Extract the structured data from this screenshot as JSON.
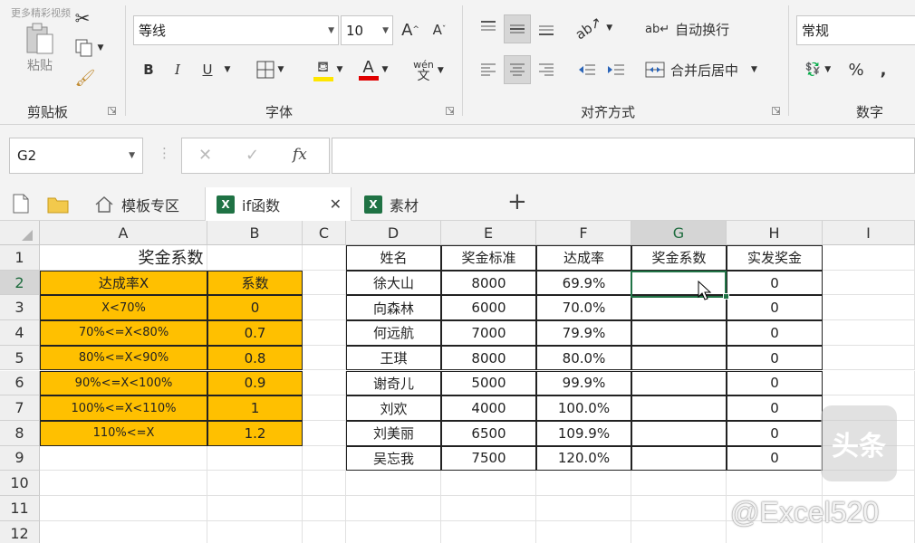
{
  "ribbon": {
    "watermark": "更多精彩视频",
    "clipboard": {
      "paste_label": "粘贴",
      "group_label": "剪贴板"
    },
    "font": {
      "font_name": "等线",
      "font_size": "10",
      "grow": "A",
      "shrink": "A",
      "bold": "B",
      "italic": "I",
      "underline": "U",
      "wen": "wén",
      "wen_char": "文",
      "font_color_letter": "A",
      "group_label": "字体"
    },
    "alignment": {
      "wrap_text": "自动换行",
      "merge_center": "合并后居中",
      "group_label": "对齐方式"
    },
    "number": {
      "format": "常规",
      "percent": "%",
      "comma": ",",
      "group_label": "数字"
    },
    "colors": {
      "highlight": "#ffe600",
      "font_red": "#e00000"
    }
  },
  "formula_bar": {
    "cell_ref": "G2",
    "cancel": "✕",
    "enter": "✓",
    "fx": "fx",
    "formula": ""
  },
  "tabs": [
    {
      "label": "模板专区",
      "icon": "home-icon"
    },
    {
      "label": "if函数",
      "icon": "excel-icon",
      "active": true,
      "close": "✕"
    },
    {
      "label": "素材",
      "icon": "excel-icon"
    }
  ],
  "tab_add": "+",
  "sheet": {
    "columns": [
      "A",
      "B",
      "C",
      "D",
      "E",
      "F",
      "G",
      "H",
      "I"
    ],
    "selected_column": "G",
    "rows": [
      "1",
      "2",
      "3",
      "4",
      "5",
      "6",
      "7",
      "8",
      "9",
      "10",
      "11",
      "12"
    ],
    "selected_row": "2",
    "left_table": {
      "title": "奖金系数",
      "headers": [
        "达成率X",
        "系数"
      ],
      "rows": [
        [
          "X<70%",
          "0"
        ],
        [
          "70%<=X<80%",
          "0.7"
        ],
        [
          "80%<=X<90%",
          "0.8"
        ],
        [
          "90%<=X<100%",
          "0.9"
        ],
        [
          "100%<=X<110%",
          "1"
        ],
        [
          "110%<=X",
          "1.2"
        ]
      ],
      "fill_color": "#ffc000"
    },
    "right_table": {
      "headers": [
        "姓名",
        "奖金标准",
        "达成率",
        "奖金系数",
        "实发奖金"
      ],
      "rows": [
        [
          "徐大山",
          "8000",
          "69.9%",
          "",
          "0"
        ],
        [
          "向森林",
          "6000",
          "70.0%",
          "",
          "0"
        ],
        [
          "何远航",
          "7000",
          "79.9%",
          "",
          "0"
        ],
        [
          "王琪",
          "8000",
          "80.0%",
          "",
          "0"
        ],
        [
          "谢奇儿",
          "5000",
          "99.9%",
          "",
          "0"
        ],
        [
          "刘欢",
          "4000",
          "100.0%",
          "",
          "0"
        ],
        [
          "刘美丽",
          "6500",
          "109.9%",
          "",
          "0"
        ],
        [
          "吴忘我",
          "7500",
          "120.0%",
          "",
          "0"
        ]
      ]
    },
    "selection_color": "#217346"
  },
  "watermark": {
    "logo": "头条",
    "handle": "@Excel520"
  }
}
